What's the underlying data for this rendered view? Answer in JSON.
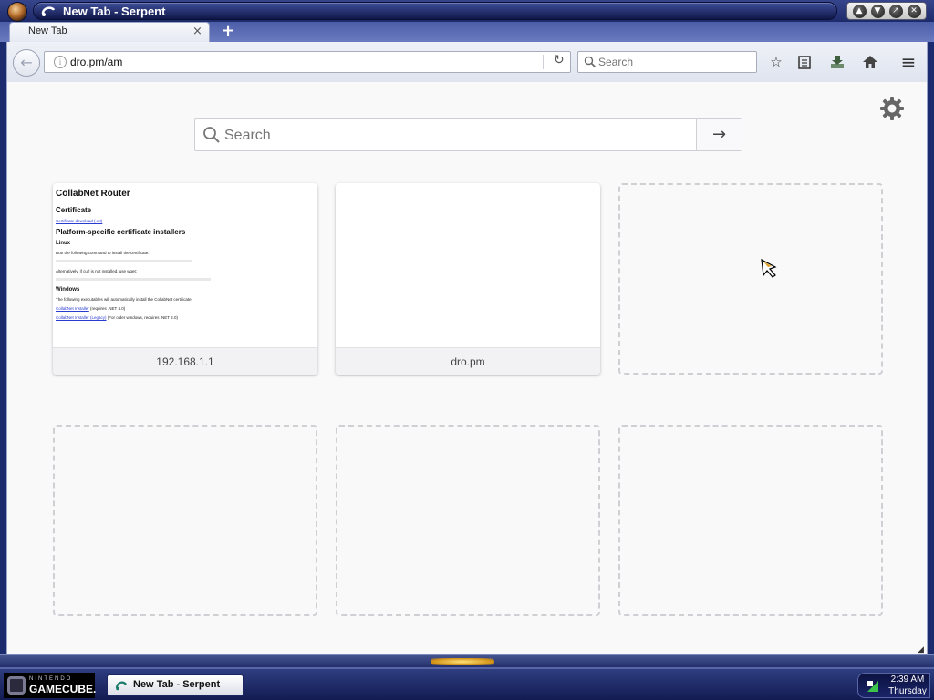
{
  "window": {
    "title": "New Tab - Serpent",
    "controls": {
      "up": "▲",
      "down": "▼",
      "maximize": "↗",
      "close": "✕"
    }
  },
  "tabs": [
    {
      "label": "New Tab",
      "active": true,
      "close": "×"
    }
  ],
  "new_tab_symbol": "+",
  "navbar": {
    "back_symbol": "←",
    "info_symbol": "i",
    "url": "dro.pm/am",
    "reload_symbol": "↻",
    "search_placeholder": "Search",
    "toolbar_icons": [
      "star-icon",
      "reading-list-icon",
      "downloads-icon",
      "home-icon",
      "menu-icon"
    ],
    "star_symbol": "☆",
    "menu_symbol": "≡"
  },
  "newtab_page": {
    "search_placeholder": "Search",
    "search_go_symbol": "→",
    "tiles": [
      {
        "caption": "192.168.1.1",
        "thumbnail": {
          "heading": "CollabNet Router",
          "section1": "Certificate",
          "link1": "Certificate download (.crt)",
          "section2": "Platform-specific certificate installers",
          "sub_linux": "Linux",
          "p1": "Run the following command to install the certificate:",
          "p2": "Alternatively, if curl is not installed, use wget:",
          "sub_windows": "Windows",
          "p3": "The following executables will automatically install the CollabNet certificate:",
          "link2": "CollabNet Installer",
          "link2_suffix": " (requires .NET 4.0)",
          "link3": "CollabNet Installer (Legacy)",
          "link3_suffix": " (For older windows, requires .NET 2.0)"
        }
      },
      {
        "caption": "dro.pm"
      }
    ],
    "empty_tiles": 4
  },
  "taskbar": {
    "start_small": "NINTENDO",
    "start_big": "GAMECUBE.",
    "task_label": "New Tab - Serpent",
    "clock_time": "2:39 AM",
    "clock_day": "Thursday"
  },
  "colors": {
    "frame_dark": "#1d2a6a",
    "frame_light": "#6a7bc0",
    "content_bg": "#f9f9fa",
    "link_blue": "#2a3bd0"
  }
}
